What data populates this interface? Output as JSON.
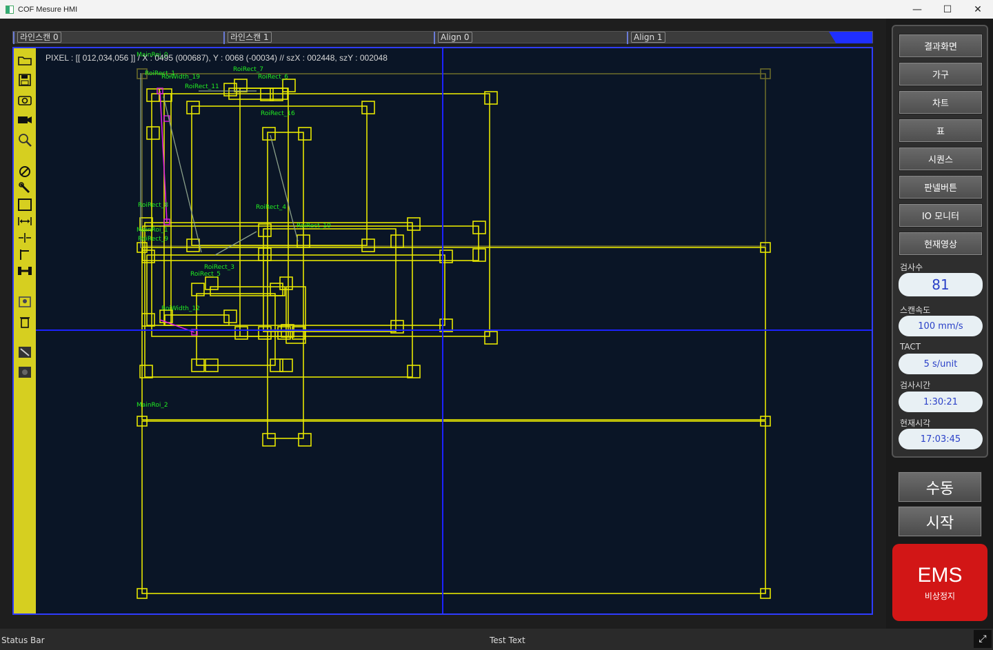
{
  "window": {
    "title": "COF Mesure HMI",
    "minimize": "—",
    "maximize": "☐",
    "close": "✕"
  },
  "tabs": [
    {
      "label": "라인스캔 0"
    },
    {
      "label": "라인스캔 1"
    },
    {
      "label": "Align 0"
    },
    {
      "label": "Align 1"
    }
  ],
  "pixel_info": "PIXEL : [[ 012,034,056 ]] / X : 0495 (000687), Y : 0068 (-00034) // szX : 002448, szY : 002048",
  "roi_labels": [
    {
      "text": "MainRoi_0"
    },
    {
      "text": "RoiRect_1"
    },
    {
      "text": "RoiWidth_19"
    },
    {
      "text": "RoiRect_7"
    },
    {
      "text": "RoiRect_6"
    },
    {
      "text": "RoiRect_11"
    },
    {
      "text": "RoiRect_16"
    },
    {
      "text": "RoiRect_8"
    },
    {
      "text": "RoiRect_4"
    },
    {
      "text": "RoiRect_10"
    },
    {
      "text": "MainRoi_1"
    },
    {
      "text": "RoiRect_9"
    },
    {
      "text": "RoiRect_3"
    },
    {
      "text": "RoiRect_5"
    },
    {
      "text": "RoiWidth_12"
    },
    {
      "text": "MainRoi_2"
    }
  ],
  "right_panel": {
    "buttons": [
      "결과화면",
      "가구",
      "차트",
      "표",
      "시퀀스",
      "판넬버튼",
      "IO 모니터",
      "현재영상"
    ],
    "stats": [
      {
        "label": "검사수",
        "value": "81"
      },
      {
        "label": "스캔속도",
        "value": "100 mm/s"
      },
      {
        "label": "TACT",
        "value": "5 s/unit"
      },
      {
        "label": "검사시간",
        "value": "1:30:21"
      },
      {
        "label": "현재시각",
        "value": "17:03:45"
      }
    ]
  },
  "manual_button": "수동",
  "start_button": "시작",
  "ems": {
    "title": "EMS",
    "subtitle": "비상정지"
  },
  "status_bar": {
    "left": "Status Bar",
    "center": "Test Text"
  },
  "colors": {
    "accent_blue": "#2f3cff",
    "roi_yellow": "#e6e600",
    "ems_red": "#d21616",
    "toolbar_yellow": "#d6cf20"
  },
  "toolbar_icons": [
    "folder-open-icon",
    "save-icon",
    "camera-icon",
    "video-camera-icon",
    "zoom-search-icon",
    "cancel-icon",
    "wrench-icon",
    "rectangle-icon",
    "width-measure-icon",
    "gap-measure-icon",
    "line-tool-icon",
    "dumbbell-icon",
    "stamp-icon",
    "trash-icon",
    "settings-wrench-icon",
    "screen-icon"
  ]
}
